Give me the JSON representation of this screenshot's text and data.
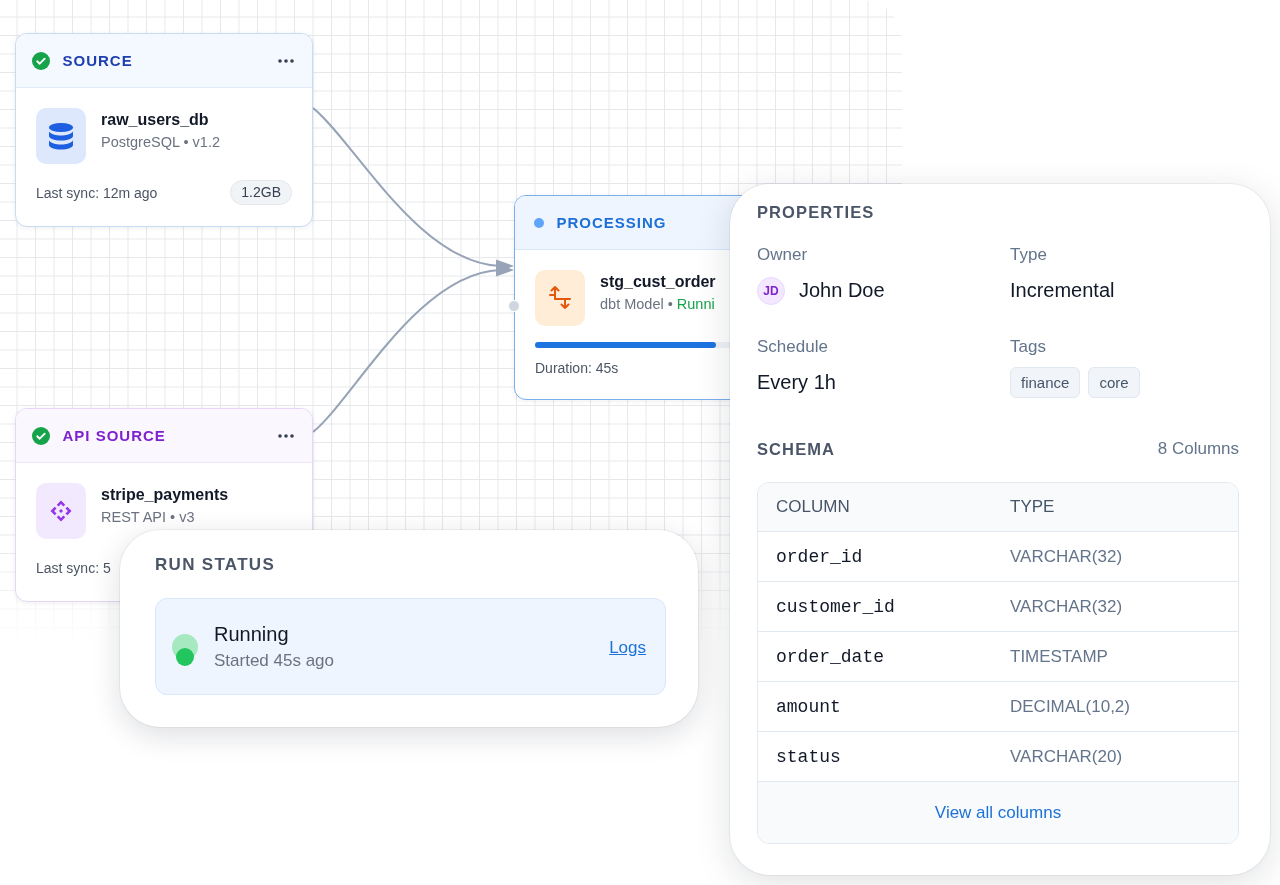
{
  "canvas": {
    "nodes": [
      {
        "kind": "database",
        "done": true,
        "label": "SOURCE",
        "title": "raw_users_db",
        "subtitle": "PostgreSQL • v1.2",
        "footer": "Last sync: 12m ago",
        "badge": "1.2GB"
      },
      {
        "kind": "api",
        "done": true,
        "label": "API SOURCE",
        "title": "stripe_payments",
        "subtitle": "REST API • v3",
        "footer": "Last sync: 5"
      },
      {
        "kind": "model",
        "done": false,
        "label": "PROCESSING",
        "title": "stg_cust_order",
        "subtitle": "dbt Model •",
        "status_text": "Runni",
        "progress": {
          "level": 0.73
        },
        "footer": "Duration: 45s"
      }
    ]
  },
  "run_status": {
    "title": "RUN STATUS",
    "active": true,
    "label": "Running",
    "detail": "Started 45s ago",
    "link": "Logs"
  },
  "properties": {
    "title": "PROPERTIES",
    "fields": [
      {
        "kind": "person",
        "label": "Owner",
        "avatar": "JD",
        "value": "John Doe"
      },
      {
        "kind": "text",
        "label": "Type",
        "value": "Incremental"
      },
      {
        "kind": "text",
        "label": "Schedule",
        "value": "Every 1h"
      },
      {
        "kind": "tags",
        "label": "Tags",
        "tags": [
          "finance",
          "core"
        ]
      }
    ],
    "schema": {
      "title": "SCHEMA",
      "count": "8 Columns",
      "columns": [
        "COLUMN",
        "TYPE"
      ],
      "rows": [
        {
          "name": "order_id",
          "type": "VARCHAR(32)"
        },
        {
          "name": "customer_id",
          "type": "VARCHAR(32)"
        },
        {
          "name": "order_date",
          "type": "TIMESTAMP"
        },
        {
          "name": "amount",
          "type": "DECIMAL(10,2)"
        },
        {
          "name": "status",
          "type": "VARCHAR(20)"
        }
      ],
      "link": "View all columns"
    }
  }
}
